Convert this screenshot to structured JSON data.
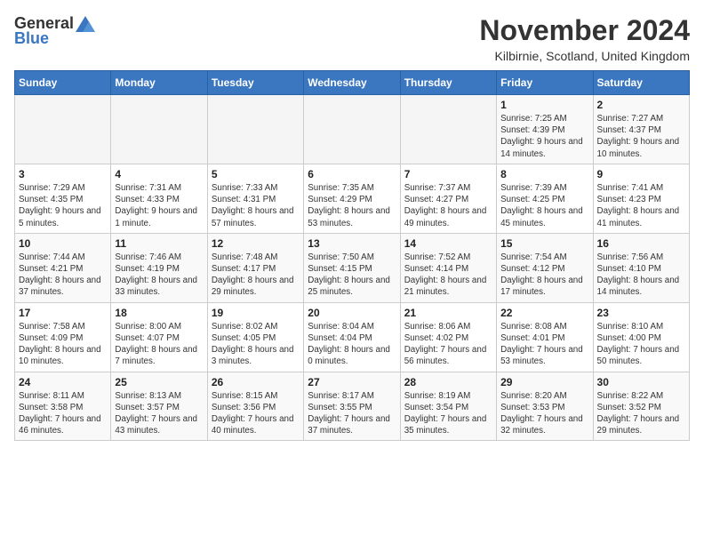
{
  "logo": {
    "general": "General",
    "blue": "Blue"
  },
  "title": "November 2024",
  "location": "Kilbirnie, Scotland, United Kingdom",
  "days_of_week": [
    "Sunday",
    "Monday",
    "Tuesday",
    "Wednesday",
    "Thursday",
    "Friday",
    "Saturday"
  ],
  "weeks": [
    [
      {
        "day": "",
        "info": ""
      },
      {
        "day": "",
        "info": ""
      },
      {
        "day": "",
        "info": ""
      },
      {
        "day": "",
        "info": ""
      },
      {
        "day": "",
        "info": ""
      },
      {
        "day": "1",
        "info": "Sunrise: 7:25 AM\nSunset: 4:39 PM\nDaylight: 9 hours and 14 minutes."
      },
      {
        "day": "2",
        "info": "Sunrise: 7:27 AM\nSunset: 4:37 PM\nDaylight: 9 hours and 10 minutes."
      }
    ],
    [
      {
        "day": "3",
        "info": "Sunrise: 7:29 AM\nSunset: 4:35 PM\nDaylight: 9 hours and 5 minutes."
      },
      {
        "day": "4",
        "info": "Sunrise: 7:31 AM\nSunset: 4:33 PM\nDaylight: 9 hours and 1 minute."
      },
      {
        "day": "5",
        "info": "Sunrise: 7:33 AM\nSunset: 4:31 PM\nDaylight: 8 hours and 57 minutes."
      },
      {
        "day": "6",
        "info": "Sunrise: 7:35 AM\nSunset: 4:29 PM\nDaylight: 8 hours and 53 minutes."
      },
      {
        "day": "7",
        "info": "Sunrise: 7:37 AM\nSunset: 4:27 PM\nDaylight: 8 hours and 49 minutes."
      },
      {
        "day": "8",
        "info": "Sunrise: 7:39 AM\nSunset: 4:25 PM\nDaylight: 8 hours and 45 minutes."
      },
      {
        "day": "9",
        "info": "Sunrise: 7:41 AM\nSunset: 4:23 PM\nDaylight: 8 hours and 41 minutes."
      }
    ],
    [
      {
        "day": "10",
        "info": "Sunrise: 7:44 AM\nSunset: 4:21 PM\nDaylight: 8 hours and 37 minutes."
      },
      {
        "day": "11",
        "info": "Sunrise: 7:46 AM\nSunset: 4:19 PM\nDaylight: 8 hours and 33 minutes."
      },
      {
        "day": "12",
        "info": "Sunrise: 7:48 AM\nSunset: 4:17 PM\nDaylight: 8 hours and 29 minutes."
      },
      {
        "day": "13",
        "info": "Sunrise: 7:50 AM\nSunset: 4:15 PM\nDaylight: 8 hours and 25 minutes."
      },
      {
        "day": "14",
        "info": "Sunrise: 7:52 AM\nSunset: 4:14 PM\nDaylight: 8 hours and 21 minutes."
      },
      {
        "day": "15",
        "info": "Sunrise: 7:54 AM\nSunset: 4:12 PM\nDaylight: 8 hours and 17 minutes."
      },
      {
        "day": "16",
        "info": "Sunrise: 7:56 AM\nSunset: 4:10 PM\nDaylight: 8 hours and 14 minutes."
      }
    ],
    [
      {
        "day": "17",
        "info": "Sunrise: 7:58 AM\nSunset: 4:09 PM\nDaylight: 8 hours and 10 minutes."
      },
      {
        "day": "18",
        "info": "Sunrise: 8:00 AM\nSunset: 4:07 PM\nDaylight: 8 hours and 7 minutes."
      },
      {
        "day": "19",
        "info": "Sunrise: 8:02 AM\nSunset: 4:05 PM\nDaylight: 8 hours and 3 minutes."
      },
      {
        "day": "20",
        "info": "Sunrise: 8:04 AM\nSunset: 4:04 PM\nDaylight: 8 hours and 0 minutes."
      },
      {
        "day": "21",
        "info": "Sunrise: 8:06 AM\nSunset: 4:02 PM\nDaylight: 7 hours and 56 minutes."
      },
      {
        "day": "22",
        "info": "Sunrise: 8:08 AM\nSunset: 4:01 PM\nDaylight: 7 hours and 53 minutes."
      },
      {
        "day": "23",
        "info": "Sunrise: 8:10 AM\nSunset: 4:00 PM\nDaylight: 7 hours and 50 minutes."
      }
    ],
    [
      {
        "day": "24",
        "info": "Sunrise: 8:11 AM\nSunset: 3:58 PM\nDaylight: 7 hours and 46 minutes."
      },
      {
        "day": "25",
        "info": "Sunrise: 8:13 AM\nSunset: 3:57 PM\nDaylight: 7 hours and 43 minutes."
      },
      {
        "day": "26",
        "info": "Sunrise: 8:15 AM\nSunset: 3:56 PM\nDaylight: 7 hours and 40 minutes."
      },
      {
        "day": "27",
        "info": "Sunrise: 8:17 AM\nSunset: 3:55 PM\nDaylight: 7 hours and 37 minutes."
      },
      {
        "day": "28",
        "info": "Sunrise: 8:19 AM\nSunset: 3:54 PM\nDaylight: 7 hours and 35 minutes."
      },
      {
        "day": "29",
        "info": "Sunrise: 8:20 AM\nSunset: 3:53 PM\nDaylight: 7 hours and 32 minutes."
      },
      {
        "day": "30",
        "info": "Sunrise: 8:22 AM\nSunset: 3:52 PM\nDaylight: 7 hours and 29 minutes."
      }
    ]
  ]
}
